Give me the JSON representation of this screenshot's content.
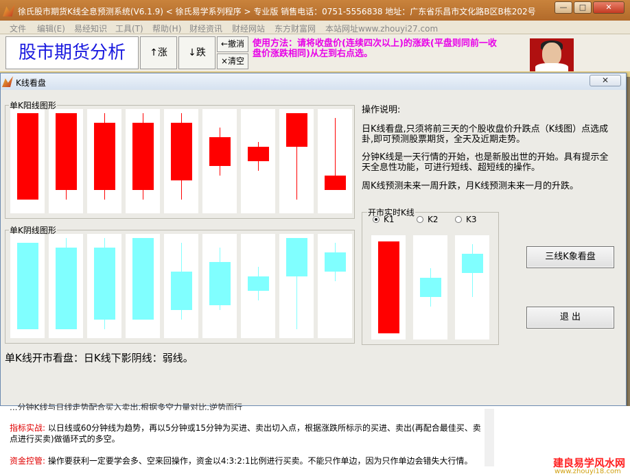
{
  "window": {
    "title": "徐氏股市期货K线全息预测系统(V6.1.9)  < 徐氏易学系列程序 > 专业版  销售电话：0751-5556838  地址：广东省乐昌市文化路B区B栋202号",
    "min": "—",
    "max": "□",
    "close": "✕"
  },
  "menu": [
    "文件",
    "编辑(E)",
    "易经知识",
    "工具(T)",
    "帮助(H)",
    "财经资讯",
    "财经网站",
    "东方财富网",
    "本站网址www.zhouyi27.com"
  ],
  "toolbar": {
    "app_title": "股市期货分析",
    "up": "↑涨",
    "down": "↓跌",
    "undo": "←撤消",
    "clear": "×清空",
    "instructions": "使用方法：请将收盘价(连续四次以上)的涨跌(平盘则同前一收盘价涨跌相同)从左到右点选。"
  },
  "dialog": {
    "title": "K线看盘",
    "close": "✕",
    "yang_group": "单K阳线图形",
    "yin_group": "单K阴线图形",
    "realtime_group": "开市实时K线",
    "radio_options": [
      {
        "label": "K1",
        "checked": true
      },
      {
        "label": "K2",
        "checked": false
      },
      {
        "label": "K3",
        "checked": false
      }
    ],
    "desc_title": "操作说明:",
    "desc_p1_l1": "日K线看盘,只须将前三天的个股收盘价升跌点（K线图）点选成",
    "desc_p1_l2": "卦,即可预测股票期货，全天及近期走势。",
    "desc_p2_l1": "分钟K线是一天行情的开始，也是新股出世的开始。具有提示全",
    "desc_p2_l2": "天全息性功能，可进行短线、超短线的操作。",
    "desc_p3": "周K线预测未来一周升跌，月K线预测未来一月的升跌。",
    "btn_three": "三线K象看盘",
    "btn_exit": "退 出",
    "status": "单K线开市看盘：日K线下影阴线：弱线。"
  },
  "bottom": {
    "line0": "...分钟K线与日线走势配合买入卖出,根据多空力量对比,逆势而行",
    "label1": "指标实战:",
    "text1a": " 以日线或60分钟线为趋势，再以5分钟或15分钟为买进、卖出切入点，根据涨跌所标示的买进、卖出(再配合最佳买、卖",
    "text1b": "点进行买卖)做循环式的多空。",
    "label2": "资金控管:",
    "text2": " 操作要获利一定要学会多、空来回操作，资金以4:3:2:1比例进行买卖。不能只作单边，因为只作单边会错失大行情。",
    "watermark": "建良易学风水网",
    "watermark_url": "www.zhouyi18.com"
  },
  "colors": {
    "yang": "#ff0000",
    "yin": "#80ffff"
  },
  "candles_yang": [
    {
      "high": 0.0,
      "low": 0.9,
      "open": 0.9,
      "close": 0.0
    },
    {
      "high": 0.0,
      "low": 0.9,
      "open": 0.8,
      "close": 0.0
    },
    {
      "high": 0.0,
      "low": 0.9,
      "open": 0.8,
      "close": 0.1
    },
    {
      "high": 0.0,
      "low": 0.9,
      "open": 0.8,
      "close": 0.1
    },
    {
      "high": 0.0,
      "low": 0.9,
      "open": 0.7,
      "close": 0.1
    },
    {
      "high": 0.15,
      "low": 0.65,
      "open": 0.55,
      "close": 0.25
    },
    {
      "high": 0.3,
      "low": 0.6,
      "open": 0.5,
      "close": 0.35
    },
    {
      "high": 0.0,
      "low": 0.9,
      "open": 0.35,
      "close": 0.0
    },
    {
      "high": 0.05,
      "low": 0.8,
      "open": 0.8,
      "close": 0.65
    }
  ],
  "candles_yin": [
    {
      "high": 0.05,
      "low": 0.95,
      "open": 0.05,
      "close": 0.95
    },
    {
      "high": 0.0,
      "low": 0.95,
      "open": 0.1,
      "close": 0.95
    },
    {
      "high": 0.0,
      "low": 0.95,
      "open": 0.1,
      "close": 0.85
    },
    {
      "high": 0.0,
      "low": 0.85,
      "open": 0.0,
      "close": 0.85
    },
    {
      "high": 0.05,
      "low": 0.85,
      "open": 0.35,
      "close": 0.75
    },
    {
      "high": 0.1,
      "low": 0.75,
      "open": 0.25,
      "close": 0.7
    },
    {
      "high": 0.3,
      "low": 0.65,
      "open": 0.4,
      "close": 0.55
    },
    {
      "high": 0.0,
      "low": 0.95,
      "open": 0.0,
      "close": 0.4
    },
    {
      "high": 0.05,
      "low": 0.45,
      "open": 0.15,
      "close": 0.35
    }
  ],
  "candles_realtime": [
    {
      "kind": "yang",
      "high": 0.02,
      "low": 0.98,
      "open": 0.98,
      "close": 0.02
    },
    {
      "kind": "yin",
      "high": 0.3,
      "low": 0.7,
      "open": 0.4,
      "close": 0.6
    },
    {
      "kind": "yin",
      "high": 0.05,
      "low": 0.6,
      "open": 0.15,
      "close": 0.35
    }
  ]
}
